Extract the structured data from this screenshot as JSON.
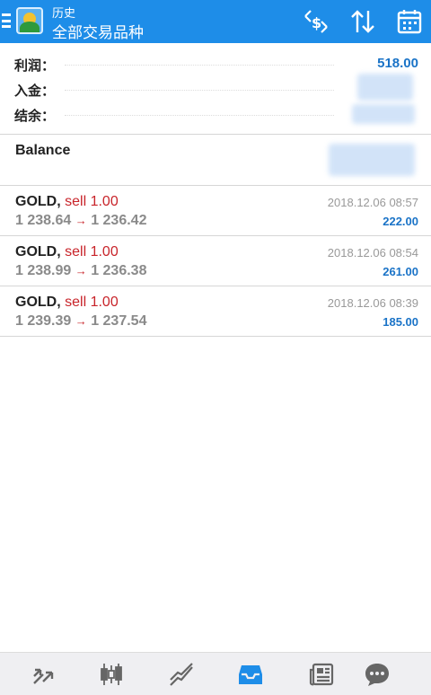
{
  "header": {
    "subtitle": "历史",
    "title": "全部交易品种",
    "icons": [
      "menu-icon",
      "metatrader-logo",
      "dollar-swap-icon",
      "sort-icon",
      "calendar-icon"
    ]
  },
  "summary": {
    "profit_label": "利润：",
    "profit_value": "518.00",
    "deposit_label": "入金：",
    "balance_label": "结余："
  },
  "balance_entry": {
    "label": "Balance"
  },
  "deals": [
    {
      "symbol": "GOLD,",
      "type": "sell 1.00",
      "time": "2018.12.06 08:57",
      "open_price": "1 238.64",
      "arrow": "→",
      "close_price": "1 236.42",
      "profit": "222.00"
    },
    {
      "symbol": "GOLD,",
      "type": "sell 1.00",
      "time": "2018.12.06 08:54",
      "open_price": "1 238.99",
      "arrow": "→",
      "close_price": "1 236.38",
      "profit": "261.00"
    },
    {
      "symbol": "GOLD,",
      "type": "sell 1.00",
      "time": "2018.12.06 08:39",
      "open_price": "1 239.39",
      "arrow": "→",
      "close_price": "1 237.54",
      "profit": "185.00"
    }
  ],
  "bottom_nav": {
    "items": [
      "trade-icon",
      "chart-candles-icon",
      "chart-line-icon",
      "history-inbox-icon",
      "news-icon",
      "chat-icon"
    ],
    "active_index": 3,
    "active_color": "#1e8de8",
    "inactive_color": "#666666"
  },
  "colors": {
    "accent": "#1e8de8",
    "sell": "#c8242a",
    "profit": "#1a73c7"
  }
}
